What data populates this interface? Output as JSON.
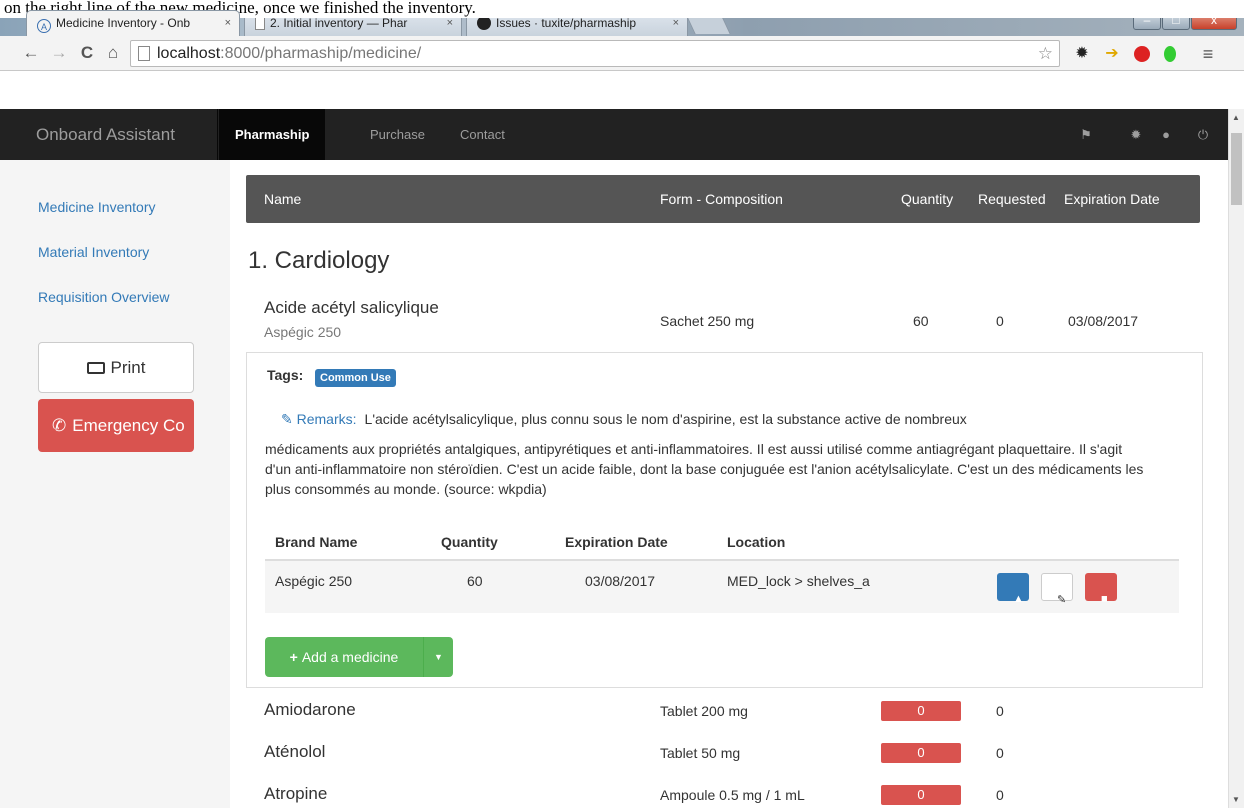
{
  "caption": "on the right line of the new medicine, once we finished the inventory.",
  "browser": {
    "tabs": [
      {
        "icon": "onboard-assistant-icon",
        "label": "Medicine Inventory - Onb",
        "close": "×"
      },
      {
        "icon": "page-icon",
        "label": "2. Initial inventory — Phar",
        "close": "×"
      },
      {
        "icon": "github-icon",
        "label": "Issues · tuxite/pharmaship",
        "close": "×"
      }
    ],
    "window_controls": {
      "minimize": "–",
      "maximize": "□",
      "close": "x"
    },
    "nav": {
      "back": "←",
      "forward": "→",
      "reload": "C",
      "home": "⌂"
    },
    "address": {
      "host": "localhost",
      "path": ":8000/pharmaship/medicine/"
    },
    "star": "☆",
    "menu": "≡"
  },
  "navbar": {
    "brand": "Onboard Assistant",
    "items": [
      {
        "label": "Pharmaship",
        "active": true
      },
      {
        "label": "Purchase",
        "active": false
      },
      {
        "label": "Contact",
        "active": false
      }
    ]
  },
  "sidebar": {
    "links": [
      "Medicine Inventory",
      "Material Inventory",
      "Requisition Overview"
    ],
    "print_label": "Print",
    "emergency_label": "Emergency Co"
  },
  "table": {
    "headers": {
      "name": "Name",
      "form": "Form - Composition",
      "quantity": "Quantity",
      "requested": "Requested",
      "expiration": "Expiration Date"
    },
    "category": "1. Cardiology",
    "expanded": {
      "name": "Acide acétyl salicylique",
      "subname": "Aspégic 250",
      "form": "Sachet 250 mg",
      "quantity": "60",
      "requested": "0",
      "expiration": "03/08/2017"
    },
    "detail": {
      "tags_label": "Tags:",
      "tag": "Common Use",
      "remarks_label": "Remarks:",
      "remarks_first": "L'acide acétylsalicylique, plus connu sous le nom d'aspirine, est la substance active de nombreux",
      "remarks_rest": "médicaments aux propriétés antalgiques, antipyrétiques et anti-inflammatoires. Il est aussi utilisé comme antiagrégant plaquettaire. Il s'agit d'un anti-inflammatoire non stéroïdien. C'est un acide faible, dont la base conjuguée est l'anion acétylsalicylate. C'est un des médicaments les plus consommés au monde. (source: wkpdia)",
      "sub_headers": {
        "brand": "Brand Name",
        "quantity": "Quantity",
        "expiration": "Expiration Date",
        "location": "Location"
      },
      "sub_row": {
        "brand": "Aspégic 250",
        "quantity": "60",
        "expiration": "03/08/2017",
        "location": "MED_lock > shelves_a"
      },
      "add_label": "Add a medicine"
    },
    "rows": [
      {
        "name": "Amiodarone",
        "form": "Tablet 200 mg",
        "quantity": "0",
        "requested": "0"
      },
      {
        "name": "Aténolol",
        "form": "Tablet 50 mg",
        "quantity": "0",
        "requested": "0"
      },
      {
        "name": "Atropine",
        "form": "Ampoule 0.5 mg / 1 mL",
        "quantity": "0",
        "requested": "0"
      }
    ]
  },
  "colors": {
    "primary": "#337ab7",
    "danger": "#d9534f",
    "success": "#5cb85c",
    "navbar": "#222222"
  }
}
